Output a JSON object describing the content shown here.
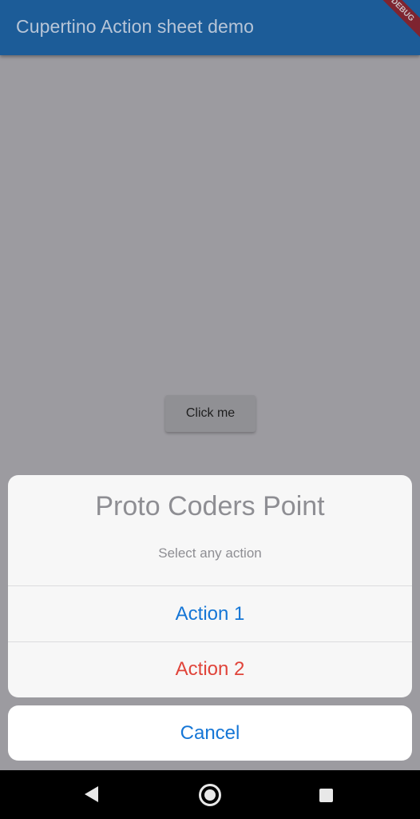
{
  "appbar": {
    "title": "Cupertino Action sheet demo",
    "debug_banner": "DEBUG",
    "color": "#1c5c98"
  },
  "main": {
    "button_label": "Click me",
    "scrim_color": "#9c9ba0"
  },
  "action_sheet": {
    "title": "Proto Coders Point",
    "message": "Select any action",
    "actions": [
      {
        "label": "Action 1",
        "color": "#1576d6"
      },
      {
        "label": "Action 2",
        "color": "#e0443a",
        "destructive": true
      }
    ],
    "cancel_label": "Cancel"
  },
  "navbar": {
    "icons": [
      "back-icon",
      "home-icon",
      "recent-apps-icon"
    ]
  }
}
